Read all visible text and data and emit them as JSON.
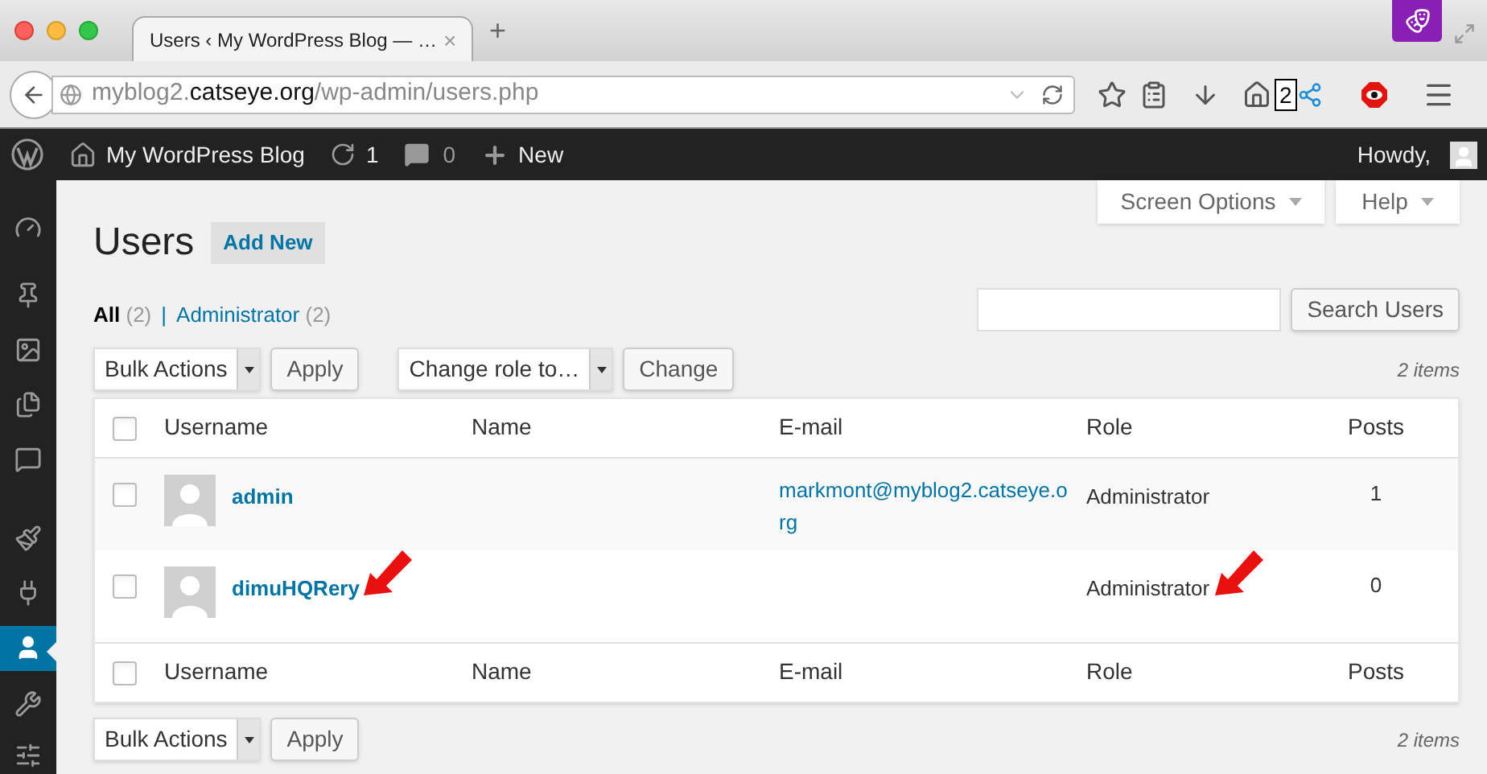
{
  "browser": {
    "tab": {
      "title": "Users ‹ My WordPress Blog — …",
      "close": "×"
    },
    "new_tab": "+",
    "url": {
      "prefix": "myblog2.",
      "domain": "catseye.org",
      "path": "/wp-admin/users.php"
    },
    "badge": "2"
  },
  "admin_bar": {
    "site": "My WordPress Blog",
    "updates": "1",
    "comments": "0",
    "new": "New",
    "greeting": "Howdy,"
  },
  "sidebar": {
    "items": [
      {
        "selected": false
      },
      {
        "selected": false
      },
      {
        "selected": false
      },
      {
        "selected": false
      },
      {
        "selected": false
      },
      {
        "selected": false
      },
      {
        "selected": false
      },
      {
        "selected": true
      },
      {
        "selected": false
      },
      {
        "selected": false
      }
    ]
  },
  "screen_options": "Screen Options",
  "help": "Help",
  "title": "Users",
  "add_new": "Add New",
  "filters": [
    {
      "label": "All",
      "count": "(2)",
      "selected": true
    },
    {
      "label": "Administrator",
      "count": "(2)",
      "selected": false
    }
  ],
  "filter_separator": "|",
  "search_button": "Search Users",
  "bulk_actions": "Bulk Actions",
  "apply": "Apply",
  "change_role": "Change role to…",
  "change": "Change",
  "items_count": "2 items",
  "table": {
    "columns": [
      "Username",
      "Name",
      "E-mail",
      "Role",
      "Posts"
    ],
    "header_checked": false,
    "footer_columns": [
      "Username",
      "Name",
      "E-mail",
      "Role",
      "Posts"
    ],
    "footer_checked": false,
    "rows": [
      {
        "username": "admin",
        "email": "markmont@myblog2.catseye.org",
        "role": "Administrator",
        "posts": "1",
        "checked": false,
        "arrows": false
      },
      {
        "username": "dimuHQRery",
        "role": "Administrator",
        "posts": "0",
        "checked": false,
        "arrows": true
      }
    ]
  },
  "bottom": {
    "bulk_actions": "Bulk Actions",
    "apply": "Apply",
    "items_count": "2 items"
  }
}
